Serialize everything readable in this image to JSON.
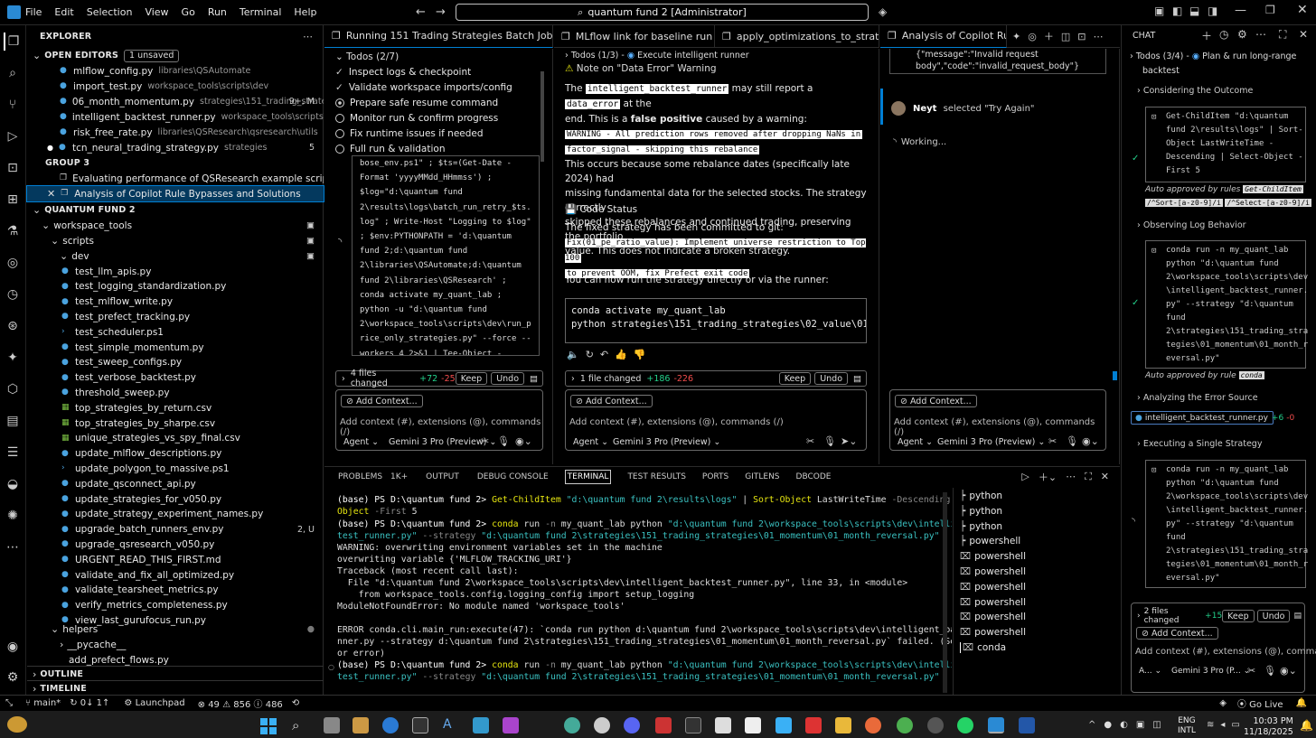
{
  "titlebar": {
    "menus": [
      "File",
      "Edit",
      "Selection",
      "View",
      "Go",
      "Run",
      "Terminal",
      "Help"
    ],
    "search": "quantum fund 2 [Administrator]"
  },
  "explorer": {
    "title": "EXPLORER",
    "open_editors": "OPEN EDITORS",
    "unsaved": "1 unsaved",
    "open_files": [
      {
        "name": "mlflow_config.py",
        "desc": "libraries\\QSAutomate",
        "badge": ""
      },
      {
        "name": "import_test.py",
        "desc": "workspace_tools\\scripts\\dev",
        "badge": ""
      },
      {
        "name": "06_month_momentum.py",
        "desc": "strategies\\151_trading_strate...",
        "badge": "9+, M"
      },
      {
        "name": "intelligent_backtest_runner.py",
        "desc": "workspace_tools\\scripts\\dev",
        "badge": ""
      },
      {
        "name": "risk_free_rate.py",
        "desc": "libraries\\QSResearch\\qsresearch\\utils",
        "badge": ""
      },
      {
        "name": "tcn_neural_trading_strategy.py",
        "desc": "strategies",
        "badge": "5"
      }
    ],
    "group3": "GROUP 3",
    "group_items": [
      "Evaluating performance of QSResearch example scripts",
      "Analysis of Copilot Rule Bypasses and Solutions"
    ],
    "project": "QUANTUM FUND 2",
    "workspace_tools": "workspace_tools",
    "scripts": "scripts",
    "dev": "dev",
    "dev_files": [
      {
        "name": "test_llm_apis.py",
        "badge": ""
      },
      {
        "name": "test_logging_standardization.py",
        "badge": ""
      },
      {
        "name": "test_mlflow_write.py",
        "badge": ""
      },
      {
        "name": "test_prefect_tracking.py",
        "badge": ""
      },
      {
        "name": "test_scheduler.ps1",
        "badge": ""
      },
      {
        "name": "test_simple_momentum.py",
        "badge": ""
      },
      {
        "name": "test_sweep_configs.py",
        "badge": ""
      },
      {
        "name": "test_verbose_backtest.py",
        "badge": ""
      },
      {
        "name": "threshold_sweep.py",
        "badge": ""
      },
      {
        "name": "top_strategies_by_return.csv",
        "badge": ""
      },
      {
        "name": "top_strategies_by_sharpe.csv",
        "badge": ""
      },
      {
        "name": "unique_strategies_vs_spy_final.csv",
        "badge": ""
      },
      {
        "name": "update_mlflow_descriptions.py",
        "badge": ""
      },
      {
        "name": "update_polygon_to_massive.ps1",
        "badge": ""
      },
      {
        "name": "update_qsconnect_api.py",
        "badge": ""
      },
      {
        "name": "update_strategies_for_v050.py",
        "badge": ""
      },
      {
        "name": "update_strategy_experiment_names.py",
        "badge": ""
      },
      {
        "name": "upgrade_batch_runners_env.py",
        "badge": "2, U"
      },
      {
        "name": "upgrade_qsresearch_v050.py",
        "badge": ""
      },
      {
        "name": "URGENT_READ_THIS_FIRST.md",
        "badge": ""
      },
      {
        "name": "validate_and_fix_all_optimized.py",
        "badge": ""
      },
      {
        "name": "validate_tearsheet_metrics.py",
        "badge": ""
      },
      {
        "name": "verify_metrics_completeness.py",
        "badge": ""
      },
      {
        "name": "view_last_gurufocus_run.py",
        "badge": ""
      }
    ],
    "helpers": "helpers",
    "pycache": "__pycache__",
    "prefect": "add_prefect_flows.py",
    "outline": "OUTLINE",
    "timeline": "TIMELINE"
  },
  "panel1": {
    "tab": "Running 151 Trading Strategies Batch Job",
    "todos_title": "Todos (2/7)",
    "todos": [
      "Inspect logs & checkpoint",
      "Validate workspace imports/config",
      "Prepare safe resume command",
      "Monitor run & confirm progress",
      "Fix runtime issues if needed",
      "Full run & validation"
    ],
    "code": [
      "bose_env.ps1\" ; $ts=(Get-Date -",
      "Format 'yyyyMMdd_HHmmss') ;",
      "$log=\"d:\\quantum fund",
      "2\\results\\logs\\batch_run_retry_$ts.",
      "log\" ; Write-Host \"Logging to $log\"",
      "; $env:PYTHONPATH = 'd:\\quantum",
      "fund 2;d:\\quantum fund",
      "2\\libraries\\QSAutomate;d:\\quantum",
      "fund 2\\libraries\\QSResearch' ;",
      "conda activate my_quant_lab ;",
      "python -u \"d:\\quantum fund",
      "2\\workspace_tools\\scripts\\dev\\run_p",
      "rice_only_strategies.py\" --force --",
      "workers 4 2>&1 | Tee-Object -",
      "FilePath $log"
    ],
    "files_changed": "4 files changed",
    "plus": "+72",
    "minus": "-25",
    "keep": "Keep",
    "undo": "Undo",
    "add_context": "Add Context...",
    "placeholder": "Add context (#), extensions (@), commands (/)",
    "agent": "Agent",
    "model": "Gemini 3 Pro (Preview)"
  },
  "panel2": {
    "tab": "MLflow link for baseline run ID",
    "tab2": "apply_optimizations_to_strat",
    "todos_title": "Todos (1/3) -",
    "todo_exec": "Execute intelligent runner",
    "note": "Note on \"Data Error\" Warning",
    "p1a": "The",
    "p1code1": "intelligent_backtest_runner",
    "p1b": "may still report a",
    "p1code2": "data_error",
    "p1c": "at the",
    "p1d": "end. This is a",
    "p1bold": "false positive",
    "p1e": "caused by a warning:",
    "warn1": "WARNING - All prediction rows removed after dropping NaNs in",
    "warn2": "factor_signal - skipping this rebalance",
    "p2": [
      "This occurs because some rebalance dates (specifically late 2024) had",
      "missing fundamental data for the selected stocks. The strategy correctly",
      "skipped these rebalances and continued trading, preserving the portfolio",
      "value. This does not indicate a broken strategy."
    ],
    "code_status": "Code Status",
    "committed": "The fixed strategy has been committed to git:",
    "commit1": "Fix(01_pe_ratio_value): Implement universe restriction to Top 100",
    "commit2": "to prevent OOM, fix Prefect exit code",
    "run_text": "You can now run the strategy directly or via the runner:",
    "cmd1": "conda activate my_quant_lab",
    "cmd2": "python strategies\\151_trading_strategies\\02_value\\01_pe",
    "files_changed": "1 file changed",
    "plus": "+186",
    "minus": "-226"
  },
  "panel3": {
    "tab": "Analysis of Copilot Rule By",
    "msg1": "{\"message\":\"Invalid request",
    "msg2": "body\",\"code\":\"invalid_request_body\"}",
    "user": "Neyt",
    "action": "selected \"Try Again\"",
    "working": "Working..."
  },
  "chat": {
    "title": "CHAT",
    "todos": "Todos (3/4) -",
    "todo_current": "Plan & run long-range",
    "todo_current2": "backtest",
    "s1": "Considering the Outcome",
    "c1": [
      "Get-ChildItem \"d:\\quantum",
      "fund 2\\results\\logs\" | Sort-",
      "Object LastWriteTime -",
      "Descending | Select-Object -",
      "First 5"
    ],
    "auto1": "Auto approved by rules",
    "r1": "Get-ChildItem",
    "r2": "/^Sort-[a-z0-9]/i",
    "r3": "/^Select-[a-z0-9]/i",
    "s2": "Observing Log Behavior",
    "c2": [
      "conda run -n my_quant_lab",
      "python \"d:\\quantum fund",
      "2\\workspace_tools\\scripts\\dev",
      "\\intelligent_backtest_runner.",
      "py\" --strategy \"d:\\quantum",
      "fund",
      "2\\strategies\\151_trading_stra",
      "tegies\\01_momentum\\01_month_r",
      "eversal.py\""
    ],
    "auto2": "Auto approved by rule",
    "r4": "conda",
    "s3": "Analyzing the Error Source",
    "file_chip": "intelligent_backtest_runner.py",
    "fplus": "+6",
    "fminus": "-0",
    "s4": "Executing a Single Strategy",
    "c3": [
      "conda run -n my_quant_lab",
      "python \"d:\\quantum fund",
      "2\\workspace_tools\\scripts\\dev",
      "\\intelligent_backtest_runner.",
      "py\" --strategy \"d:\\quantum",
      "fund",
      "2\\strategies\\151_trading_stra",
      "tegies\\01_momentum\\01_month_r",
      "eversal.py\""
    ],
    "files_changed": "2 files changed",
    "plus": "+15",
    "keep": "Keep",
    "undo": "Undo",
    "add_context": "Add Context...",
    "placeholder": "Add context (#), extensions (@), command",
    "agent": "A...",
    "model": "Gemini 3 Pro (P..."
  },
  "panel_tabs": {
    "problems": "PROBLEMS",
    "problems_count": "1K+",
    "output": "OUTPUT",
    "debug": "DEBUG CONSOLE",
    "terminal": "TERMINAL",
    "test": "TEST RESULTS",
    "ports": "PORTS",
    "gitlens": "GITLENS",
    "dbcode": "DBCODE"
  },
  "terminal_list": [
    "python",
    "python",
    "python",
    "powershell",
    "powershell",
    "powershell",
    "powershell",
    "powershell",
    "powershell",
    "powershell",
    "conda"
  ],
  "statusbar": {
    "branch": "main*",
    "sync": "0↓ 1↑",
    "launchpad": "Launchpad",
    "errors": "49",
    "warnings": "856",
    "info": "486",
    "golive": "Go Live"
  },
  "taskbar": {
    "lang": "ENG",
    "region": "INTL",
    "time": "10:03 PM",
    "date": "11/18/2025"
  },
  "colors": {
    "accent": "#007fd4",
    "selection": "#04395e",
    "green": "#23d18b",
    "red": "#f14c4c",
    "yellow": "#e5e510"
  }
}
